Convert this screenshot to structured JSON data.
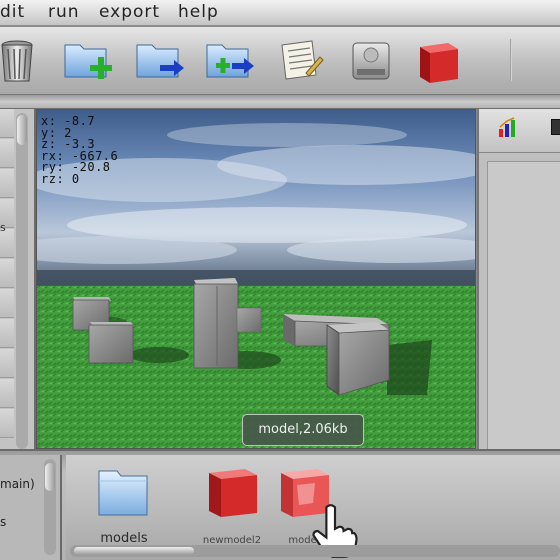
{
  "menu": {
    "edit": "dit",
    "run": "run",
    "export": "export",
    "help": "help"
  },
  "toolbar": {
    "buttons": [
      {
        "icon": "trash-can-icon"
      },
      {
        "icon": "new-folder-icon"
      },
      {
        "icon": "move-to-folder-icon"
      },
      {
        "icon": "copy-to-folder-icon"
      },
      {
        "icon": "notes-icon"
      },
      {
        "icon": "disk-drive-icon"
      },
      {
        "icon": "red-cube-icon"
      }
    ]
  },
  "viewport": {
    "coords": {
      "x": "x: -8.7",
      "y": "y: 2",
      "z": "z: -3.3",
      "rx": "rx: -667.6",
      "ry": "ry: -20.8",
      "rz": "rz: 0"
    },
    "tooltip": "model,2.06kb"
  },
  "left_panel": {
    "fragment": "s"
  },
  "bottom_left": {
    "line1": "main)",
    "line2": "s"
  },
  "shelf": {
    "items": [
      {
        "label": "models",
        "icon": "folder-icon"
      },
      {
        "label": "newmodel2",
        "icon": "red-cube-icon"
      },
      {
        "label": "model",
        "icon": "red-cube-icon"
      }
    ]
  },
  "colors": {
    "cube_red": "#d42a2a",
    "grass": "#3f9e3a",
    "sky": "#7d9cc4",
    "tooltip_bg": "#46584a"
  }
}
